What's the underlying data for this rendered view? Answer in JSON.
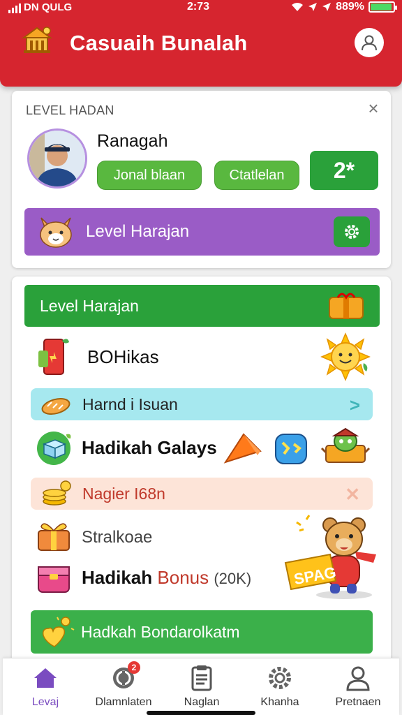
{
  "status_bar": {
    "carrier": "DN QULG",
    "time": "2:73",
    "battery": "889%"
  },
  "header": {
    "title": "Casuaih Bunalah"
  },
  "profile_card": {
    "heading": "LEVEL HADAN",
    "user_name": "Ranagah",
    "button_1": "Jonal blaan",
    "button_2": "Ctatlelan",
    "level_value": "2*",
    "purple_bar_label": "Level Harajan"
  },
  "rewards_card": {
    "header_label": "Level Harajan",
    "row_1": "BOHikas",
    "band_1": "Harnd i Isuan",
    "row_2": "Hadikah Galays",
    "band_2": "Nagier I68n",
    "row_3": "Stralkoae",
    "row_4_main": "Hadikah",
    "row_4_accent": "Bonus",
    "row_4_suffix": "(20K)",
    "sticker_text": "SPAG",
    "footer_button": "Hadkah Bondarolkatm"
  },
  "colors": {
    "brand_red": "#d6252f",
    "green": "#2aa13a",
    "purple": "#9a5cc6",
    "nav_active": "#7a4cc0"
  },
  "bottom_nav": {
    "items": [
      {
        "label": "Levaj",
        "icon": "home-icon"
      },
      {
        "label": "Dlamnlaten",
        "icon": "coin-icon",
        "badge": "2"
      },
      {
        "label": "Naglan",
        "icon": "clipboard-icon"
      },
      {
        "label": "Khanha",
        "icon": "gear-icon"
      },
      {
        "label": "Pretnaen",
        "icon": "user-icon"
      }
    ]
  }
}
